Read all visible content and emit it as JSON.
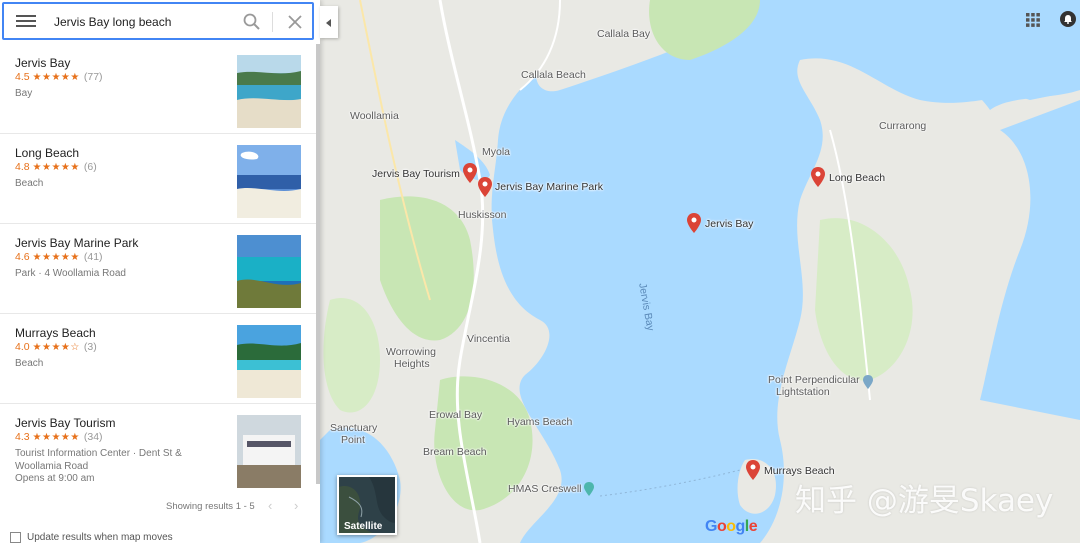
{
  "search": {
    "value": "Jervis Bay long beach"
  },
  "results": [
    {
      "title": "Jervis Bay",
      "rating": "4.5",
      "stars": "★★★★★",
      "count": "(77)",
      "type": "Bay",
      "extra": ""
    },
    {
      "title": "Long Beach",
      "rating": "4.8",
      "stars": "★★★★★",
      "count": "(6)",
      "type": "Beach",
      "extra": ""
    },
    {
      "title": "Jervis Bay Marine Park",
      "rating": "4.6",
      "stars": "★★★★★",
      "count": "(41)",
      "type": "Park · 4 Woollamia Road",
      "extra": ""
    },
    {
      "title": "Murrays Beach",
      "rating": "4.0",
      "stars": "★★★★☆",
      "count": "(3)",
      "type": "Beach",
      "extra": ""
    },
    {
      "title": "Jervis Bay Tourism",
      "rating": "4.3",
      "stars": "★★★★★",
      "count": "(34)",
      "type": "Tourist Information Center · Dent St & Woollamia Road",
      "extra": "Opens at 9:00 am"
    }
  ],
  "pager": {
    "text": "Showing results 1 - 5",
    "prev": "‹",
    "next": "›"
  },
  "update_label": "Update results when map moves",
  "satellite_label": "Satellite",
  "map_labels": {
    "callala_bay": "Callala Bay",
    "callala_beach": "Callala Beach",
    "woollamia": "Woollamia",
    "myola": "Myola",
    "huskisson": "Huskisson",
    "currarong": "Currarong",
    "jervis_bay_water": "Jervis Bay",
    "vincentia": "Vincentia",
    "worrowing": "Worrowing",
    "heights": "Heights",
    "erowal_bay": "Erowal Bay",
    "hyams_beach": "Hyams Beach",
    "sanctuary": "Sanctuary",
    "point": "Point",
    "bream_beach": "Bream Beach",
    "hmas_creswell": "HMAS Creswell",
    "point_perpendicular": "Point Perpendicular",
    "lightstation": "Lightstation"
  },
  "pins": {
    "tourism": "Jervis Bay Tourism",
    "marine_park": "Jervis Bay Marine Park",
    "long_beach": "Long Beach",
    "jervis_bay": "Jervis Bay",
    "murrays_beach": "Murrays Beach"
  },
  "logo": {
    "g1": "G",
    "o1": "o",
    "o2": "o",
    "g2": "g",
    "l": "l",
    "e": "e"
  },
  "watermark": "知乎 @游旻Skaey",
  "colors": {
    "accent": "#4285f4",
    "pin": "#db4437",
    "star": "#e7711b",
    "water": "#aadaff",
    "land": "#e8e8e3",
    "park": "#c8e6b4"
  }
}
